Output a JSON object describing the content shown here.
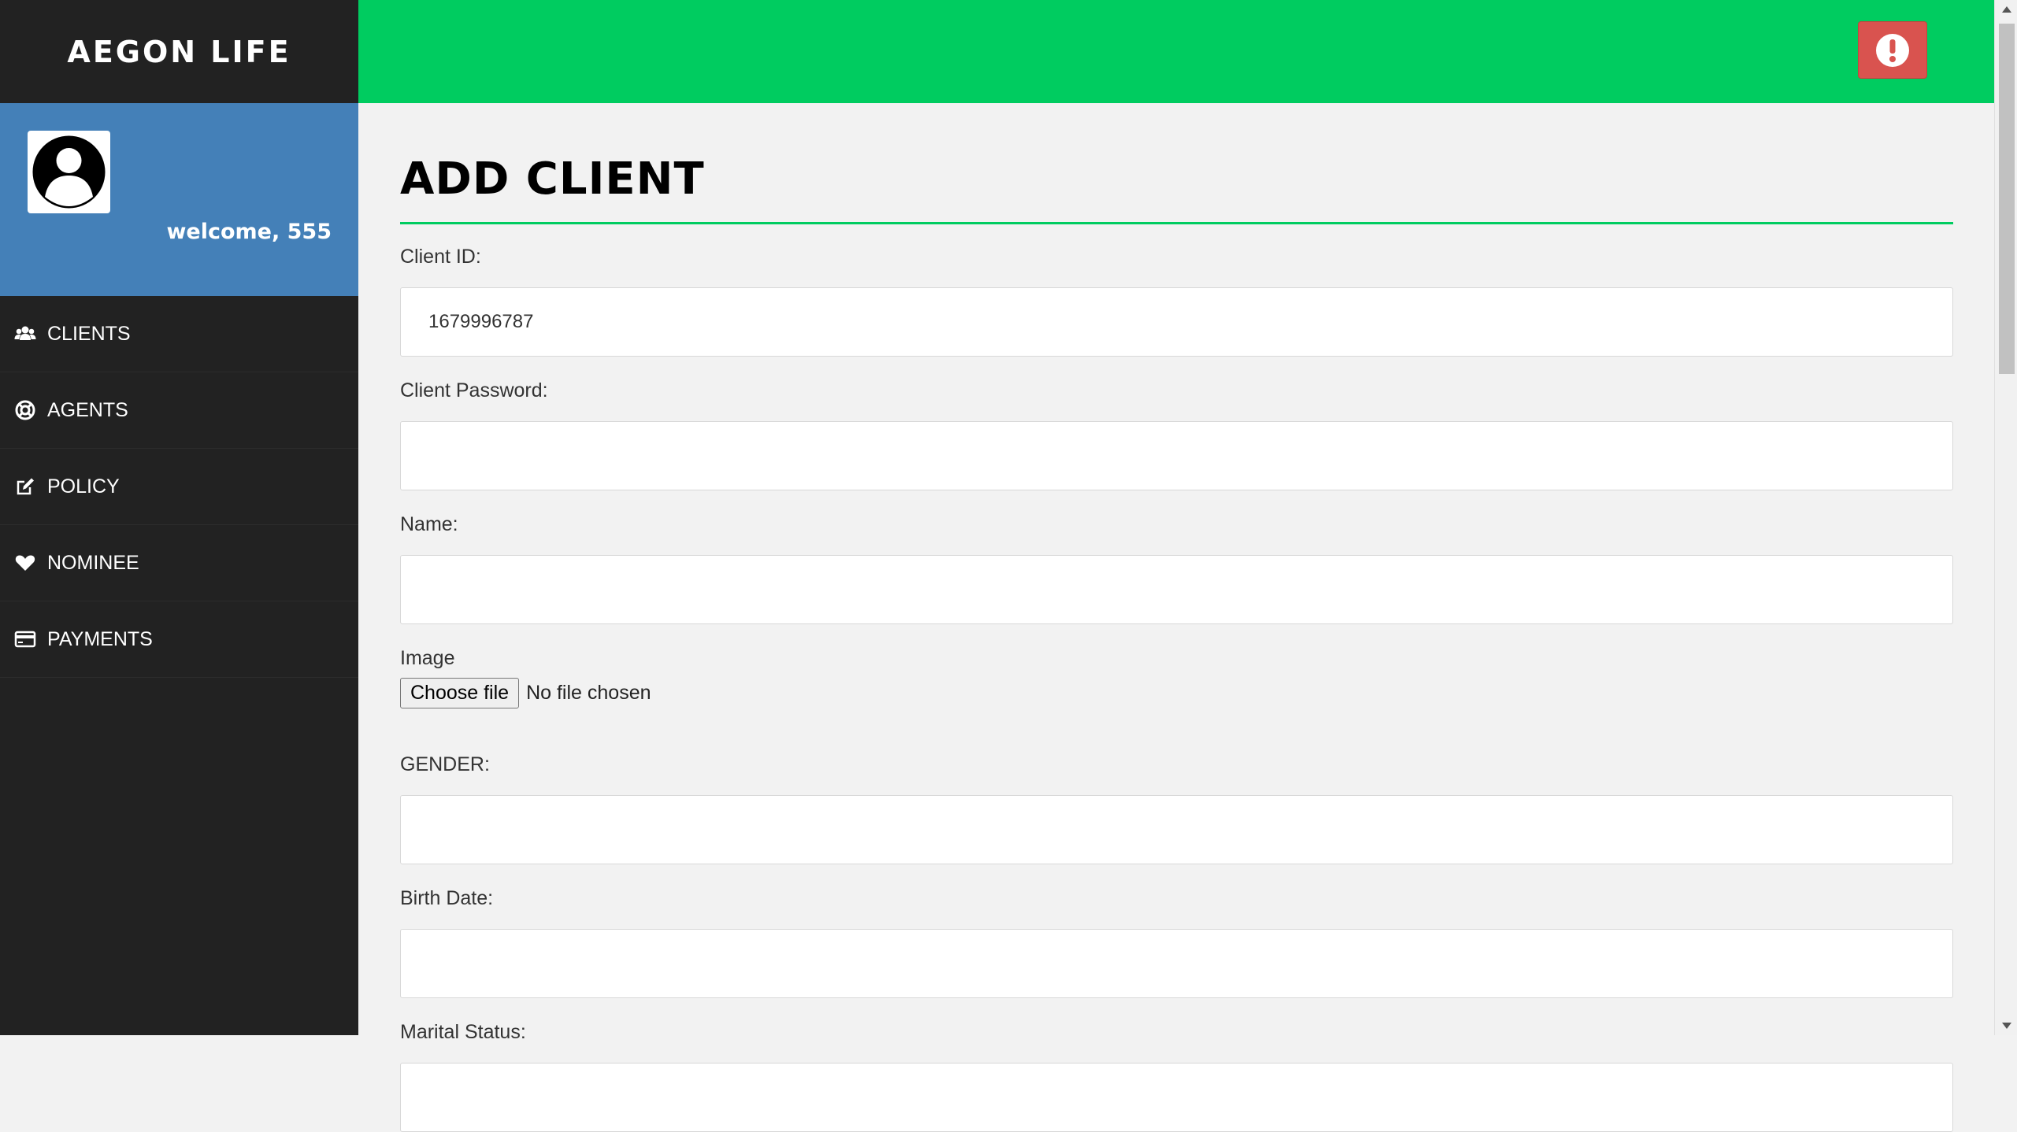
{
  "brand": "AEGON LIFE",
  "user": {
    "welcome": "welcome, 555"
  },
  "nav": [
    {
      "label": "CLIENTS",
      "icon": "users-icon"
    },
    {
      "label": "AGENTS",
      "icon": "life-ring-icon"
    },
    {
      "label": "POLICY",
      "icon": "edit-icon"
    },
    {
      "label": "NOMINEE",
      "icon": "heart-icon"
    },
    {
      "label": "PAYMENTS",
      "icon": "credit-card-icon"
    }
  ],
  "colors": {
    "sidebar": "#222222",
    "profile": "#4480b8",
    "topbar": "#00cc60",
    "alert": "#d9534f"
  },
  "page": {
    "title": "ADD CLIENT"
  },
  "form": {
    "client_id": {
      "label": "Client ID:",
      "value": "1679996787"
    },
    "client_password": {
      "label": "Client Password:",
      "value": ""
    },
    "name": {
      "label": "Name:",
      "value": ""
    },
    "image": {
      "label": "Image",
      "button": "Choose file",
      "status": "No file chosen"
    },
    "gender": {
      "label": "GENDER:",
      "value": ""
    },
    "birth_date": {
      "label": "Birth Date:",
      "value": ""
    },
    "marital_status": {
      "label": "Marital Status:",
      "value": ""
    }
  }
}
